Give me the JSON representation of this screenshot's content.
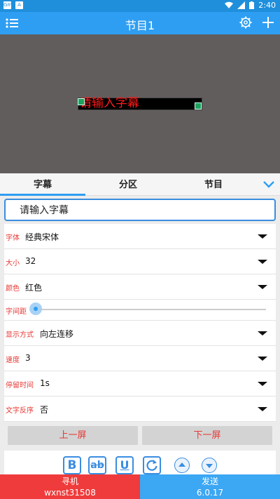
{
  "status_bar": {
    "left_icons": [
      "Gm",
      "A"
    ],
    "time": "2:40"
  },
  "app_bar": {
    "title": "节目1",
    "icons": [
      "menu-icon",
      "gear-icon",
      "plus-icon"
    ]
  },
  "preview": {
    "caption_text": "请输入字幕",
    "caption_color": "#ff1a1a"
  },
  "tabs": [
    {
      "label": "字幕",
      "active": true
    },
    {
      "label": "分区",
      "active": false
    },
    {
      "label": "节目",
      "active": false
    }
  ],
  "caption_input": {
    "value": "请输入字幕"
  },
  "settings": {
    "font": {
      "label": "字体",
      "value": "经典宋体"
    },
    "size": {
      "label": "大小",
      "value": "32"
    },
    "color": {
      "label": "颜色",
      "value": "红色"
    },
    "spacing": {
      "label": "字间距",
      "level": 0
    },
    "display_mode": {
      "label": "显示方式",
      "value": "向左连移"
    },
    "speed": {
      "label": "速度",
      "value": "3"
    },
    "pause_time": {
      "label": "停留时间",
      "value": "1s"
    },
    "reverse": {
      "label": "文字反序",
      "value": "否"
    }
  },
  "screen_buttons": {
    "prev": "上一屏",
    "next": "下一屏"
  },
  "format_buttons": {
    "bold": "B",
    "strike": "ab",
    "underline": "U"
  },
  "bottom": {
    "left_title": "寻机",
    "left_sub": "wxnst31508",
    "right_title": "发送",
    "right_sub": "6.0.17"
  },
  "colors": {
    "primary": "#2e9ef2",
    "danger": "#ef3b3b",
    "label_red": "#e53935"
  }
}
